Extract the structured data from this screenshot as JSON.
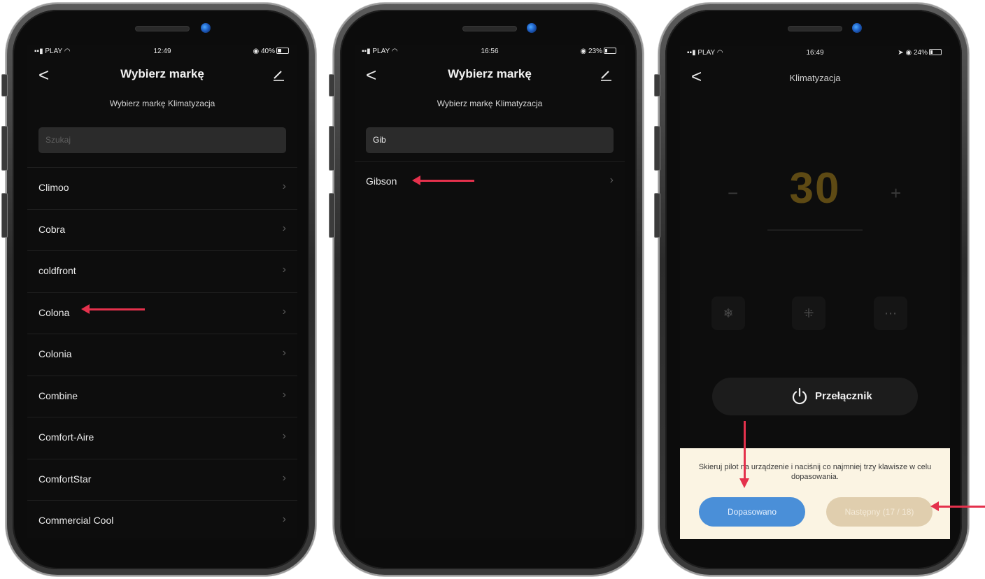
{
  "phone1": {
    "status": {
      "carrier": "PLAY",
      "time": "12:49",
      "battery": "40%"
    },
    "nav": {
      "back": "<",
      "title": "Wybierz markę"
    },
    "subtitle": "Wybierz markę Klimatyzacja",
    "search": {
      "placeholder": "Szukaj"
    },
    "brands": [
      "Climoo",
      "Cobra",
      "coldfront",
      "Colona",
      "Colonia",
      "Combine",
      "Comfort-Aire",
      "ComfortStar",
      "Commercial Cool"
    ]
  },
  "phone2": {
    "status": {
      "carrier": "PLAY",
      "time": "16:56",
      "battery": "23%"
    },
    "nav": {
      "back": "<",
      "title": "Wybierz markę"
    },
    "subtitle": "Wybierz markę Klimatyzacja",
    "search": {
      "value": "Gib"
    },
    "brands": [
      "Gibson"
    ]
  },
  "phone3": {
    "status": {
      "carrier": "PLAY",
      "time": "16:49",
      "battery": "24%"
    },
    "nav": {
      "back": "<",
      "title": "Klimatyzacja"
    },
    "temperature": "30",
    "minus": "−",
    "plus": "+",
    "power_label": "Przełącznik",
    "match_text": "Skieruj pilot na urządzenie i naciśnij co najmniej trzy klawisze w celu dopasowania.",
    "matched_button": "Dopasowano",
    "next_button": "Następny (17 / 18)"
  },
  "chevron": "›",
  "colors": {
    "accent_red": "#e4314c",
    "match_blue": "#4a8fd8",
    "next_beige": "#e0ceae",
    "temp_gold": "#5e4a14"
  }
}
